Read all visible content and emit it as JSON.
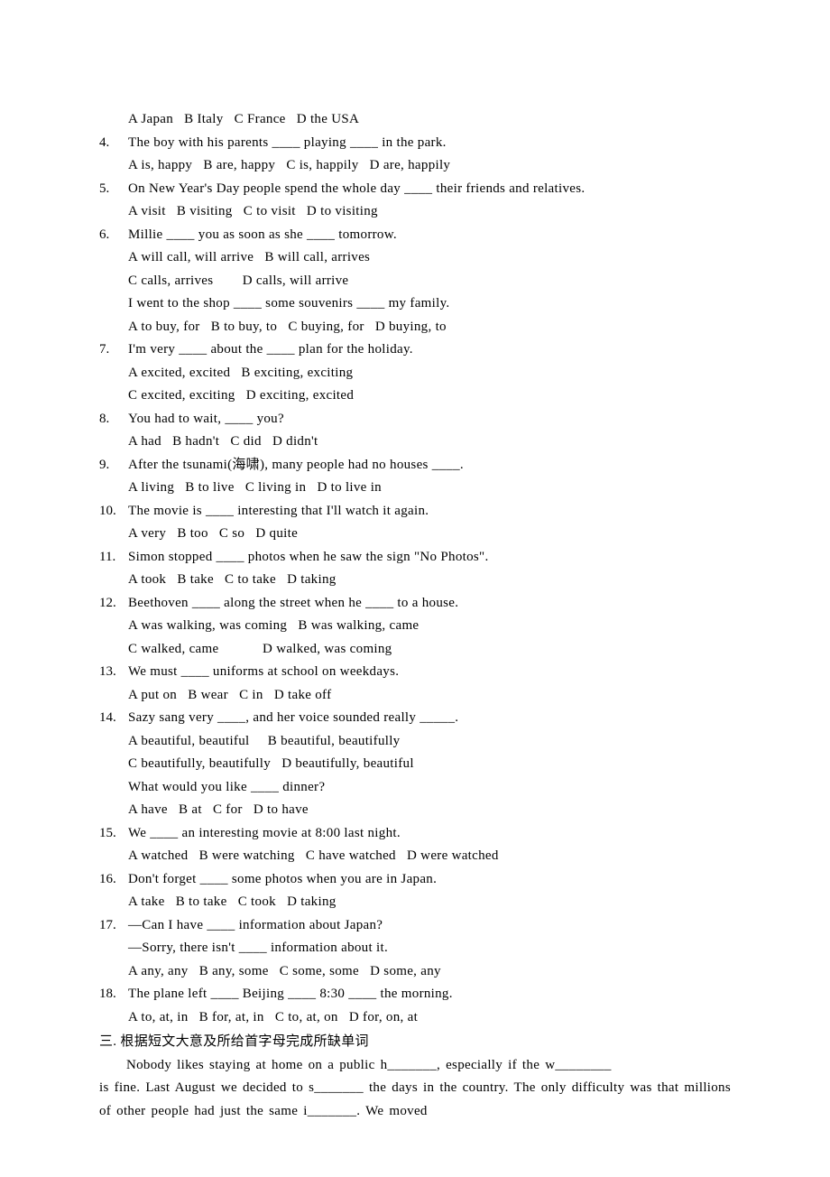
{
  "opts_top": "A Japan   B Italy   C France   D the USA",
  "questions": [
    {
      "num": "4.",
      "text": "The boy with his parents ____ playing ____ in the park.",
      "opts": "A is, happy   B are, happy   C is, happily   D are, happily"
    },
    {
      "num": "5.",
      "text": "On New Year's Day people spend the whole day ____ their friends and relatives.",
      "opts": "A visit   B visiting   C to visit   D to visiting"
    },
    {
      "num": "6.",
      "text": "Millie ____ you as soon as she ____ tomorrow.",
      "opts": "A will call, will arrive   B will call, arrives",
      "opts2": "C calls, arrives        D calls, will arrive",
      "extra1": "I went to the shop ____ some souvenirs ____ my family.",
      "extra1opts": "A to buy, for   B to buy, to   C buying, for   D buying, to"
    },
    {
      "num": "7.",
      "text": "I'm very ____ about the ____ plan for the holiday.",
      "opts": "A excited, excited   B exciting, exciting",
      "opts2": "C excited, exciting   D exciting, excited"
    },
    {
      "num": "8.",
      "text": "You had to wait, ____ you?",
      "opts": "A had   B hadn't   C did   D didn't"
    },
    {
      "num": "9.",
      "text": "After the tsunami(海啸), many people had no houses ____.",
      "opts": "A living   B to live   C living in   D to live in"
    },
    {
      "num": "10.",
      "text": "The movie is ____ interesting that I'll watch it again.",
      "opts": "A very   B too   C so   D quite"
    },
    {
      "num": "11.",
      "text": "Simon stopped ____ photos when he saw the sign \"No Photos\".",
      "opts": "A took   B take   C to take   D taking"
    },
    {
      "num": "12.",
      "text": "Beethoven ____ along the street when he ____ to a house.",
      "opts": "A was walking, was coming   B was walking, came",
      "opts2": "C walked, came            D walked, was coming"
    },
    {
      "num": "13.",
      "text": "We must ____ uniforms at school on weekdays.",
      "opts": "A put on   B wear   C in   D take off"
    },
    {
      "num": "14.",
      "text": "Sazy sang very ____, and her voice sounded really _____.",
      "opts": "A beautiful, beautiful     B beautiful, beautifully",
      "opts2": "C beautifully, beautifully   D beautifully, beautiful",
      "extra1": "What would you like ____ dinner?",
      "extra1opts": "A have   B at   C for   D to have"
    },
    {
      "num": "15.",
      "text": "We ____ an interesting movie at 8:00 last night.",
      "opts": "A watched   B were watching   C have watched   D were watched"
    },
    {
      "num": "16.",
      "text": "Don't forget ____ some photos when you are in Japan.",
      "opts": "A take   B to take   C took   D taking"
    },
    {
      "num": "17.",
      "text": "—Can I have ____ information about Japan?",
      "line2": "—Sorry, there isn't ____ information about it.",
      "opts": "A any, any   B any, some   C some, some   D some, any"
    },
    {
      "num": "18.",
      "text": "The plane left ____ Beijing ____ 8:30 ____ the morning.",
      "opts": "A to, at, in   B for, at, in   C to, at, on   D for, on, at"
    }
  ],
  "section3_heading": "三. 根据短文大意及所给首字母完成所缺单词",
  "passage_line1": "Nobody likes staying at home on a public h_______, especially if the w________",
  "passage_line2": "is fine. Last August we decided to s_______ the days in the country. The only difficulty was that millions of other people had just the same i_______. We moved"
}
